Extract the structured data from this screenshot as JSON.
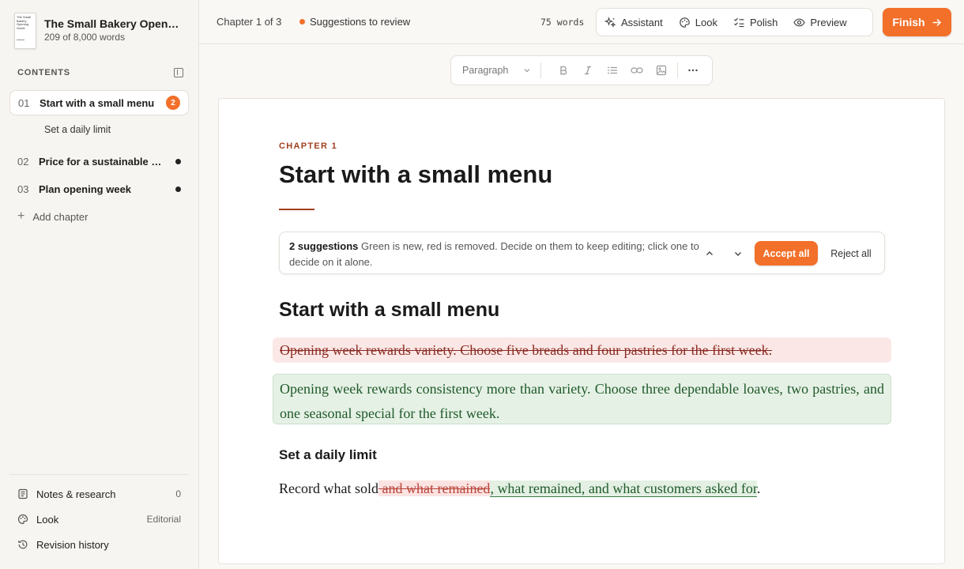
{
  "book": {
    "cover_lines": [
      "The Small",
      "Bakery",
      "Opening",
      "Guide"
    ],
    "title": "The Small Bakery Opening Guide",
    "word_count": "209 of 8,000 words"
  },
  "sidebar": {
    "contents_label": "CONTENTS",
    "chapters": [
      {
        "num": "01",
        "label": "Start with a small menu",
        "badge": "2"
      },
      {
        "num": "02",
        "label": "Price for a sustainable week"
      },
      {
        "num": "03",
        "label": "Plan opening week"
      }
    ],
    "sub_item": "Set a daily limit",
    "add_chapter": "Add chapter",
    "footer": [
      {
        "label": "Notes & research",
        "value": "0",
        "icon": "notes-icon"
      },
      {
        "label": "Look",
        "value": "Editorial",
        "icon": "palette-icon"
      },
      {
        "label": "Revision history",
        "value": "",
        "icon": "history-icon"
      }
    ]
  },
  "topbar": {
    "chapter_of": "Chapter 1 of 3",
    "status": "Suggestions to review",
    "words": "75 words",
    "tools": [
      {
        "label": "Assistant",
        "icon": "sparkles-icon"
      },
      {
        "label": "Look",
        "icon": "palette-icon"
      },
      {
        "label": "Polish",
        "icon": "checklist-icon"
      },
      {
        "label": "Preview",
        "icon": "eye-icon"
      }
    ],
    "finish": "Finish"
  },
  "format_toolbar": {
    "block_type": "Paragraph"
  },
  "page": {
    "kicker": "CHAPTER 1",
    "title": "Start with a small menu",
    "suggestions": {
      "count_label": "2 suggestions",
      "help_text": "Green is new, red is removed. Decide on them to keep editing; click one to decide on it alone.",
      "accept_all": "Accept all",
      "reject_all": "Reject all"
    },
    "heading": "Start with a small menu",
    "deleted_paragraph": "Opening week rewards variety. Choose five breads and four pastries for the first week.",
    "inserted_paragraph": "Opening week rewards consistency more than variety. Choose three dependable loaves, two pastries, and one seasonal special for the first week.",
    "subheading": "Set a daily limit",
    "para_start": "Record what sold",
    "para_deleted": " and what remained",
    "para_inserted": ", what remained, and what customers asked for",
    "para_end": "."
  },
  "colors": {
    "accent": "#f2702a",
    "deletion_bg": "#fbe8e6",
    "insertion_bg": "#e6f1e6",
    "kicker": "#a0401e"
  }
}
